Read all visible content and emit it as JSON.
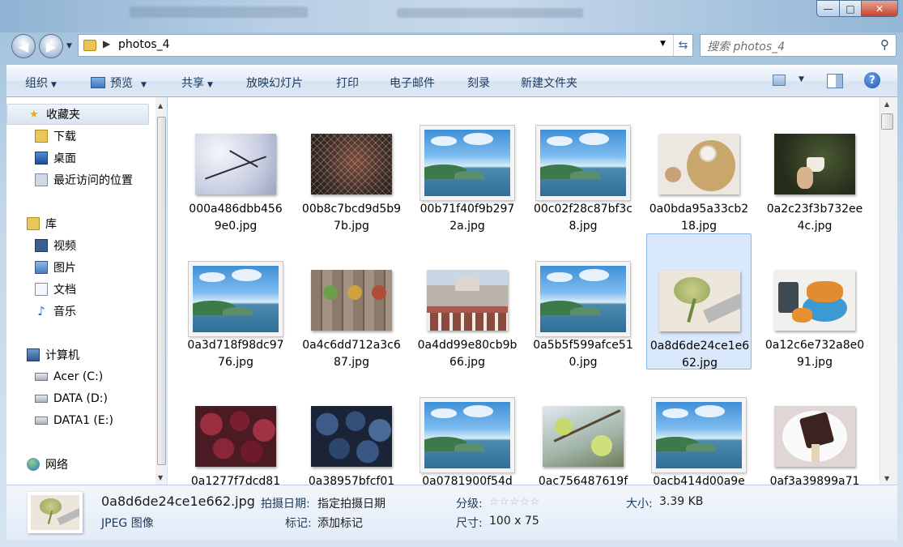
{
  "window": {
    "close_glyph": "✕",
    "max_glyph": "□",
    "min_glyph": "—"
  },
  "address": {
    "path": "photos_4",
    "separator": "▶"
  },
  "search": {
    "placeholder": "搜索 photos_4"
  },
  "toolbar": {
    "organize": "组织",
    "preview": "预览",
    "share": "共享",
    "slideshow": "放映幻灯片",
    "print": "打印",
    "email": "电子邮件",
    "burn": "刻录",
    "new_folder": "新建文件夹",
    "help": "?"
  },
  "nav": {
    "favorites": "收藏夹",
    "downloads": "下载",
    "desktop": "桌面",
    "recent": "最近访问的位置",
    "libraries": "库",
    "videos": "视频",
    "pictures": "图片",
    "documents": "文档",
    "music": "音乐",
    "computer": "计算机",
    "drive_c": "Acer (C:)",
    "drive_d": "DATA (D:)",
    "drive_e": "DATA1 (E:)",
    "network": "网络"
  },
  "files": [
    {
      "name": "000a486dbb4569e0.jpg",
      "art": "snow"
    },
    {
      "name": "00b8c7bcd9d5b97b.jpg",
      "art": "net"
    },
    {
      "name": "00b71f40f9b2972a.jpg",
      "art": "sea"
    },
    {
      "name": "00c02f28c87bf3c8.jpg",
      "art": "sea"
    },
    {
      "name": "0a0bda95a33cb218.jpg",
      "art": "coffee"
    },
    {
      "name": "0a2c23f3b732ee4c.jpg",
      "art": "cup"
    },
    {
      "name": "0a3d718f98dc9776.jpg",
      "art": "sea"
    },
    {
      "name": "0a4c6dd712a3c687.jpg",
      "art": "wood"
    },
    {
      "name": "0a4dd99e80cb9b66.jpg",
      "art": "building"
    },
    {
      "name": "0a5b5f599afce510.jpg",
      "art": "sea"
    },
    {
      "name": "0a8d6de24ce1e662.jpg",
      "art": "bouquet"
    },
    {
      "name": "0a12c6e732a8e091.jpg",
      "art": "croissant"
    },
    {
      "name": "0a1277f7dcd81",
      "art": "grapes"
    },
    {
      "name": "0a38957bfcf01",
      "art": "blueberry"
    },
    {
      "name": "0a0781900f54d",
      "art": "sea"
    },
    {
      "name": "0ac756487619f",
      "art": "apple"
    },
    {
      "name": "0acb414d00a9e",
      "art": "sea"
    },
    {
      "name": "0af3a39899a71",
      "art": "icecream"
    }
  ],
  "details": {
    "filename": "0a8d6de24ce1e662.jpg",
    "type": "JPEG 图像",
    "date_label": "拍摄日期:",
    "date_value": "指定拍摄日期",
    "tags_label": "标记:",
    "tags_value": "添加标记",
    "rating_label": "分级:",
    "rating_stars": "☆☆☆☆☆",
    "dim_label": "尺寸:",
    "dim_value": "100 x 75",
    "size_label": "大小:",
    "size_value": "3.39 KB"
  },
  "colors": {
    "selection": "#d9e8fb",
    "accent": "#1e395b"
  }
}
